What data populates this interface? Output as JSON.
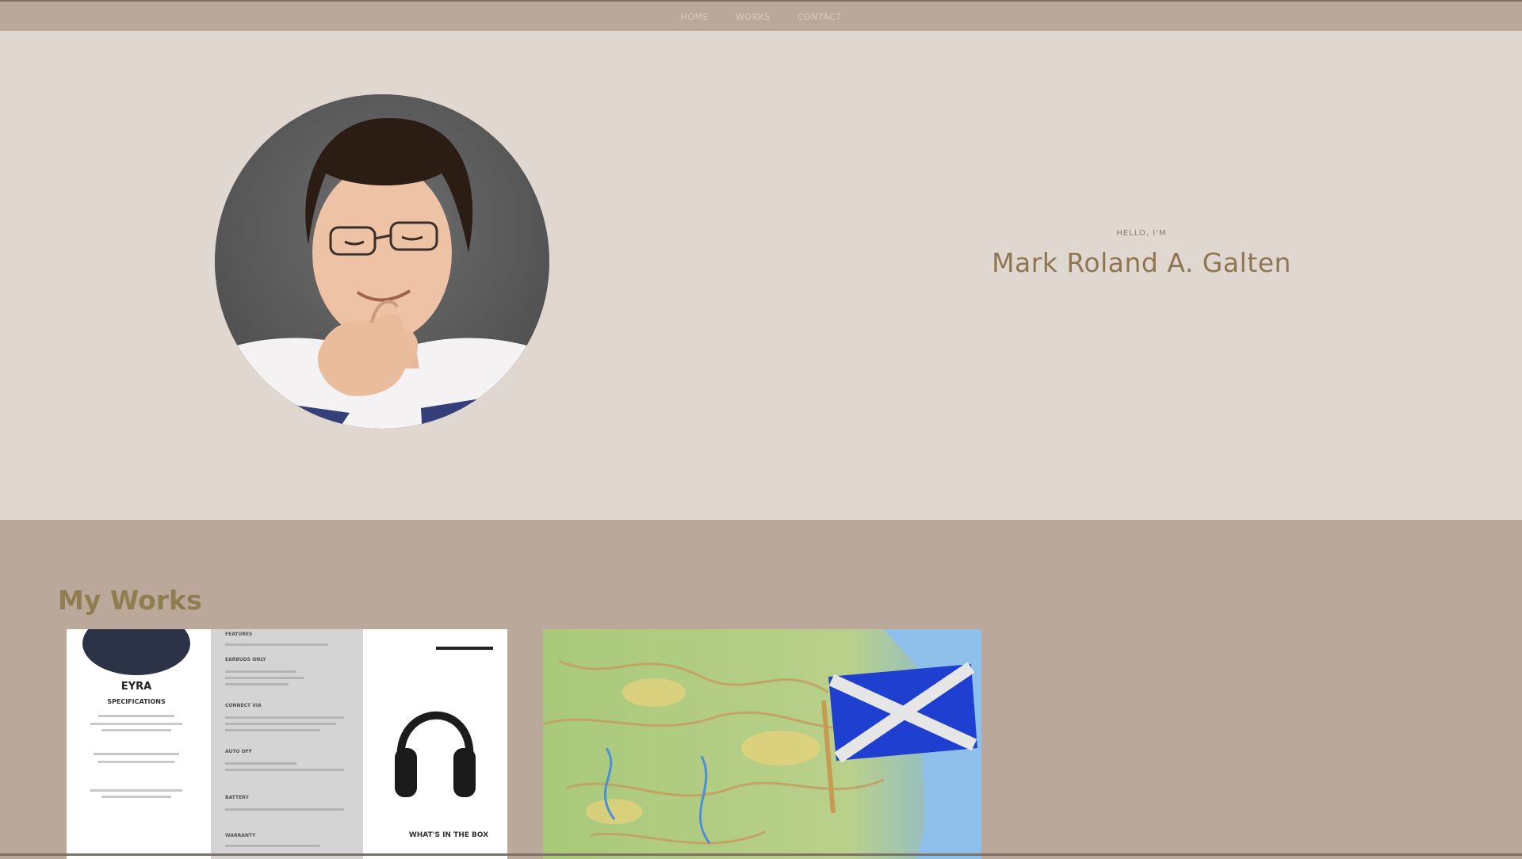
{
  "nav": {
    "items": [
      {
        "label": "HOME"
      },
      {
        "label": "WORKS"
      },
      {
        "label": "CONTACT"
      }
    ]
  },
  "hero": {
    "kicker": "HELLO, I'M",
    "name": "Mark Roland A. Galten"
  },
  "works": {
    "title": "My Works",
    "items": [
      {
        "name": "brochure",
        "texts": [
          "EYRA",
          "SPECIFICATIONS",
          "FEATURES",
          "EARBUDS ONLY",
          "CONNECT VIA",
          "AUTO OFF",
          "BATTERY",
          "WARRANTY",
          "WHAT'S IN THE BOX"
        ]
      },
      {
        "name": "scotland-map"
      }
    ]
  },
  "colors": {
    "topbar": "#baa99a",
    "hero_bg": "#e0d7d0",
    "works_bg": "#baa99a",
    "name_color": "#8e7652",
    "title_color": "#8f7d50"
  }
}
